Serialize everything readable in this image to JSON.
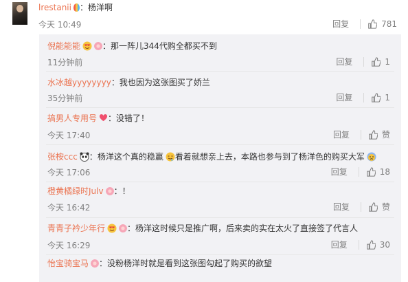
{
  "main": {
    "username": "lrestanii",
    "content": "杨洋啊",
    "time": "今天 10:49",
    "reply_label": "回复",
    "like_count": "781"
  },
  "comments": [
    {
      "user": "倪能能能",
      "content": "那一阵儿344代购全都买不到",
      "time": "11分钟前",
      "reply": "回复",
      "likes": "1"
    },
    {
      "user": "水冰越yyyyyyyy",
      "content": "我也因为这张图买了娇兰",
      "time": "35分钟前",
      "reply": "回复",
      "likes": "1"
    },
    {
      "user": "搞男人专用号",
      "content": "没错了！",
      "time": "今天 17:40",
      "reply": "回复",
      "likes": "赞"
    },
    {
      "user": "张桉ccc",
      "content": "杨洋这个真的稳赢",
      "content2": "看着就想亲上去，本路也参与到了杨洋色的购买大军",
      "time": "今天 17:06",
      "reply": "回复",
      "likes": "18"
    },
    {
      "user": "橙黄橘绿时Julv",
      "content": "！",
      "time": "今天 16:42",
      "reply": "回复",
      "likes": "赞"
    },
    {
      "user": "青青子衿少年行",
      "content": "杨洋这时候只是推广啊，后来卖的实在太火了直接签了代言人",
      "time": "今天 16:29",
      "reply": "回复",
      "likes": "30"
    },
    {
      "user": "怡宝骑宝马",
      "content": "没粉杨洋时就是看到这张图勾起了购买的欲望",
      "time": "",
      "reply": "",
      "likes": ""
    }
  ]
}
